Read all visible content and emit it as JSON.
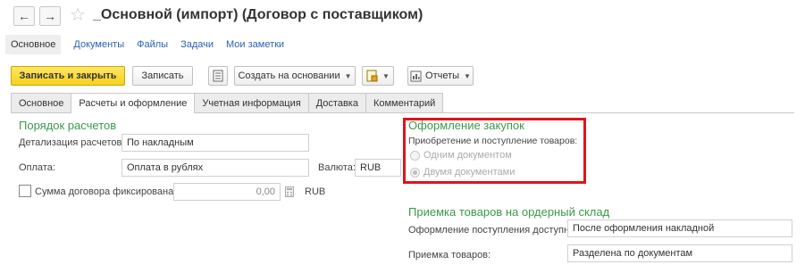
{
  "header": {
    "title": "_Основной (импорт) (Договор с поставщиком)",
    "back_icon": "←",
    "forward_icon": "→",
    "favorite_icon": "☆"
  },
  "nav": {
    "active": "Основное",
    "links": [
      "Документы",
      "Файлы",
      "Задачи",
      "Мои заметки"
    ]
  },
  "toolbar": {
    "save_close": "Записать и закрыть",
    "save": "Записать",
    "create_based": "Создать на основании",
    "reports": "Отчеты"
  },
  "tabs": [
    "Основное",
    "Расчеты и оформление",
    "Учетная информация",
    "Доставка",
    "Комментарий"
  ],
  "active_tab_index": 1,
  "payments": {
    "title": "Порядок расчетов",
    "detail_label": "Детализация расчетов:",
    "detail_value": "По накладным",
    "payment_label": "Оплата:",
    "payment_value": "Оплата в рублях",
    "currency_label": "Валюта:",
    "currency_value": "RUB",
    "fixed_sum_label": "Сумма договора фиксирована",
    "fixed_sum_checked": false,
    "sum_value": "0,00",
    "sum_currency": "RUB"
  },
  "purchase": {
    "title": "Оформление закупок",
    "subtitle": "Приобретение и поступление товаров:",
    "option_one": "Одним документом",
    "option_two": "Двумя документами",
    "selected": "Двумя документами",
    "highlight_color": "#e0141b"
  },
  "warehouse": {
    "title": "Приемка товаров на ордерный склад",
    "receipt_label": "Оформление поступления доступно:",
    "receipt_value": "После оформления накладной",
    "acceptance_label": "Приемка товаров:",
    "acceptance_value": "Разделена по документам"
  },
  "colors": {
    "accent_green": "#3a9a49",
    "link_blue": "#2a62b1",
    "primary_yellow": "#f7d21c"
  }
}
